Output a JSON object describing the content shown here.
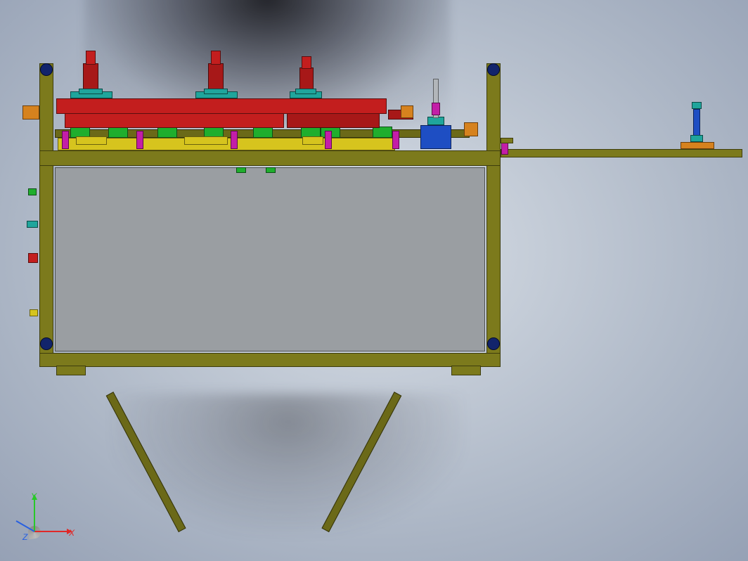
{
  "triad": {
    "x_label": "X",
    "y_label": "Y",
    "z_label": "Z"
  },
  "colors": {
    "olive": "#7c7a1c",
    "red": "#c31e1e",
    "teal": "#1fa59c",
    "green": "#1fae2d",
    "magenta": "#c31ea7",
    "blue": "#1e4ec3",
    "navy": "#12246b",
    "yellow": "#d6c41e",
    "orange": "#d6821e",
    "grey_panel": "#9a9ea2"
  },
  "view": "front-orthographic",
  "assembly": {
    "frames": [
      "main-cabinet",
      "right-shelf",
      "angled-legs"
    ],
    "corner_bolts": 4,
    "red_cylinders": 3
  }
}
